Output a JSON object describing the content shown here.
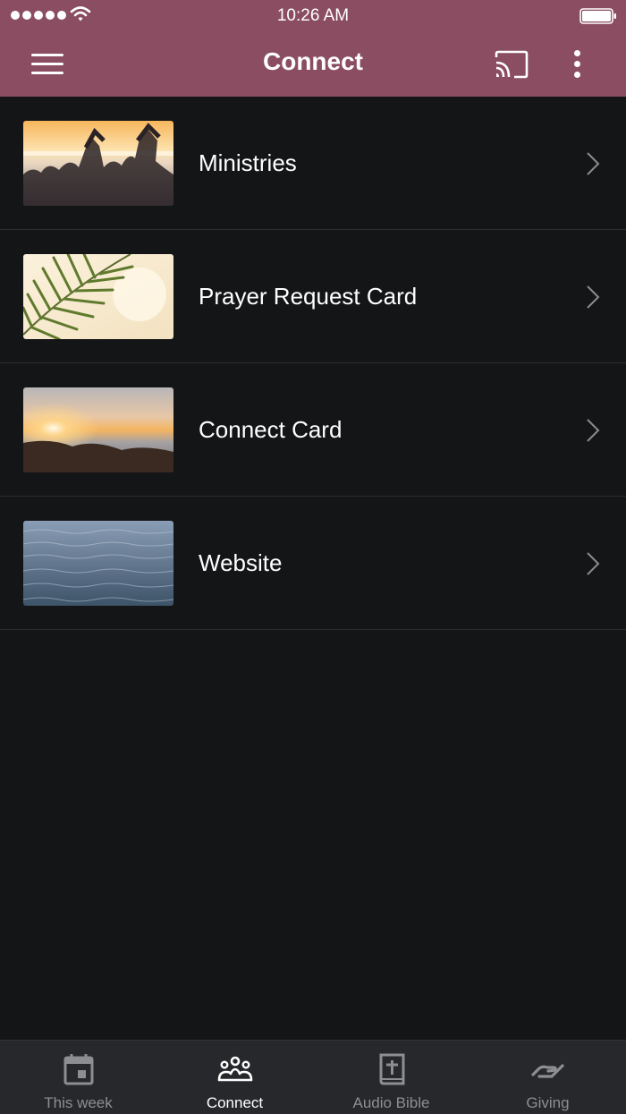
{
  "status_bar": {
    "time": "10:26 AM"
  },
  "header": {
    "title": "Connect"
  },
  "colors": {
    "accent": "#8a4d61",
    "background": "#141517",
    "tabbar": "#27282b"
  },
  "list": {
    "items": [
      {
        "label": "Ministries",
        "thumbnail": "friends-heart-hands-sunset-image"
      },
      {
        "label": "Prayer Request Card",
        "thumbnail": "palm-leaf-image"
      },
      {
        "label": "Connect Card",
        "thumbnail": "mountain-sunrise-image"
      },
      {
        "label": "Website",
        "thumbnail": "ocean-water-image"
      }
    ]
  },
  "tabs": [
    {
      "label": "This week",
      "icon": "calendar-icon",
      "active": false
    },
    {
      "label": "Connect",
      "icon": "people-group-icon",
      "active": true
    },
    {
      "label": "Audio Bible",
      "icon": "bible-icon",
      "active": false
    },
    {
      "label": "Giving",
      "icon": "giving-hand-icon",
      "active": false
    }
  ]
}
